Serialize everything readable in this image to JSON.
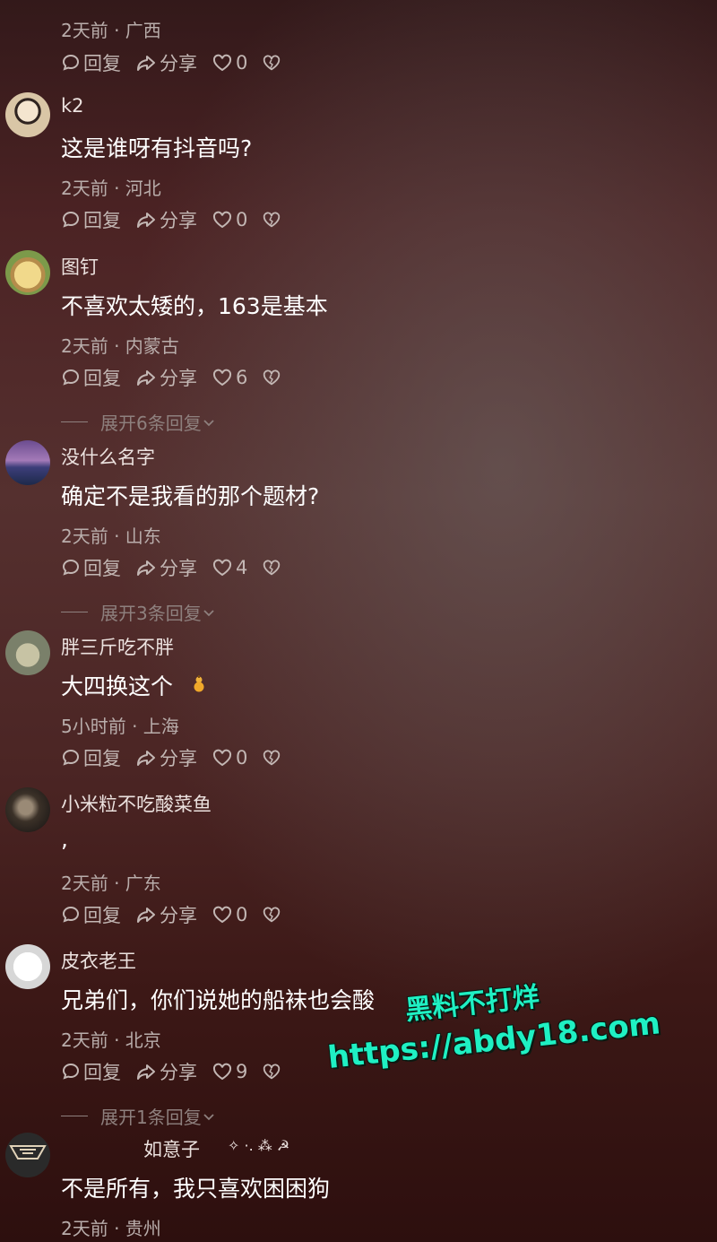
{
  "actions": {
    "reply": "回复",
    "share": "分享"
  },
  "first_partial": {
    "meta": "2天前 · 广西",
    "likes": "0"
  },
  "comments": [
    {
      "name": "k2",
      "content": "这是谁呀有抖音吗?",
      "meta": "2天前 · 河北",
      "likes": "0",
      "expand": ""
    },
    {
      "name": "图钉",
      "content": "不喜欢太矮的，163是基本",
      "meta": "2天前 · 内蒙古",
      "likes": "6",
      "expand": "展开6条回复"
    },
    {
      "name": "没什么名字",
      "content": "确定不是我看的那个题材?",
      "meta": "2天前 · 山东",
      "likes": "4",
      "expand": "展开3条回复"
    },
    {
      "name": "胖三斤吃不胖",
      "content": "大四换这个",
      "meta": "5小时前 · 上海",
      "likes": "0",
      "expand": ""
    },
    {
      "name": "小米粒不吃酸菜鱼",
      "content": ",",
      "meta": "2天前 · 广东",
      "likes": "0",
      "expand": ""
    },
    {
      "name": "皮衣老王",
      "content": "兄弟们，你们说她的船袜也会酸",
      "meta": "2天前 · 北京",
      "likes": "9",
      "expand": "展开1条回复"
    },
    {
      "name": "如意子",
      "content": "不是所有，我只喜欢困困狗",
      "meta": "2天前 · 贵州",
      "likes": "",
      "expand": ""
    }
  ],
  "watermark": {
    "line1": "黑料不打烊",
    "line2": "https://abdy18.com"
  },
  "colors": {
    "watermark": "#1ff0c3",
    "meta_text": "#b9adab",
    "content_text": "#ffffff"
  }
}
